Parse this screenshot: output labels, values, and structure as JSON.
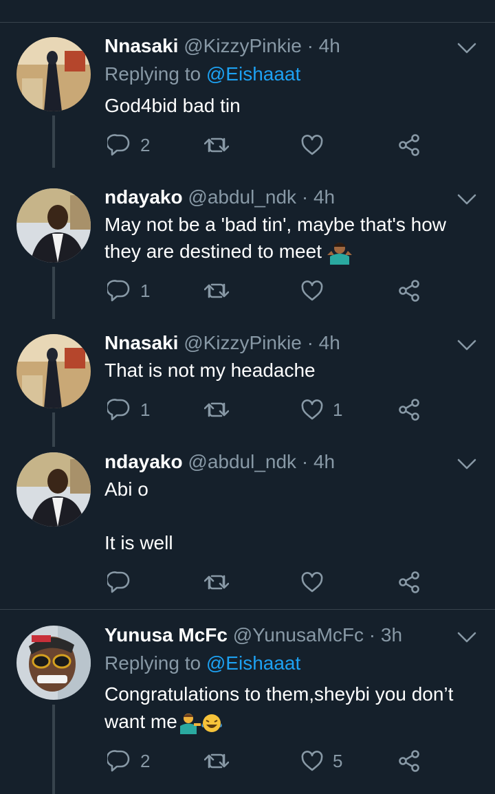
{
  "colors": {
    "background": "#15202b",
    "divider": "#38444d",
    "secondary_text": "#8899a6",
    "link": "#1da1f2"
  },
  "tweets": [
    {
      "name": "Nnasaki",
      "handle": "@KizzyPinkie",
      "time": "4h",
      "replying_prefix": "Replying to",
      "replying_to": "@Eishaaat",
      "lines": [
        "God4bid bad tin"
      ],
      "replies": "2",
      "retweets": "",
      "likes": ""
    },
    {
      "name": "ndayako",
      "handle": "@abdul_ndk",
      "time": "4h",
      "lines": [
        "May not be a 'bad tin', maybe that's how",
        "they are destined to meet"
      ],
      "emoji": "man-shrugging-emoji",
      "replies": "1",
      "retweets": "",
      "likes": ""
    },
    {
      "name": "Nnasaki",
      "handle": "@KizzyPinkie",
      "time": "4h",
      "lines": [
        "That is not my headache"
      ],
      "replies": "1",
      "retweets": "",
      "likes": "1"
    },
    {
      "name": "ndayako",
      "handle": "@abdul_ndk",
      "time": "4h",
      "lines": [
        "Abi o",
        "It is well"
      ],
      "replies": "",
      "retweets": "",
      "likes": ""
    },
    {
      "name": "Yunusa McFc",
      "handle": "@YunusaMcFc",
      "time": "3h",
      "replying_prefix": "Replying to",
      "replying_to": "@Eishaaat",
      "lines": [
        "Congratulations to them,sheybi you don’t",
        "want me"
      ],
      "emoji": "man-tipping-hand-and-laughing-emojis",
      "replies": "2",
      "retweets": "",
      "likes": "5"
    }
  ]
}
